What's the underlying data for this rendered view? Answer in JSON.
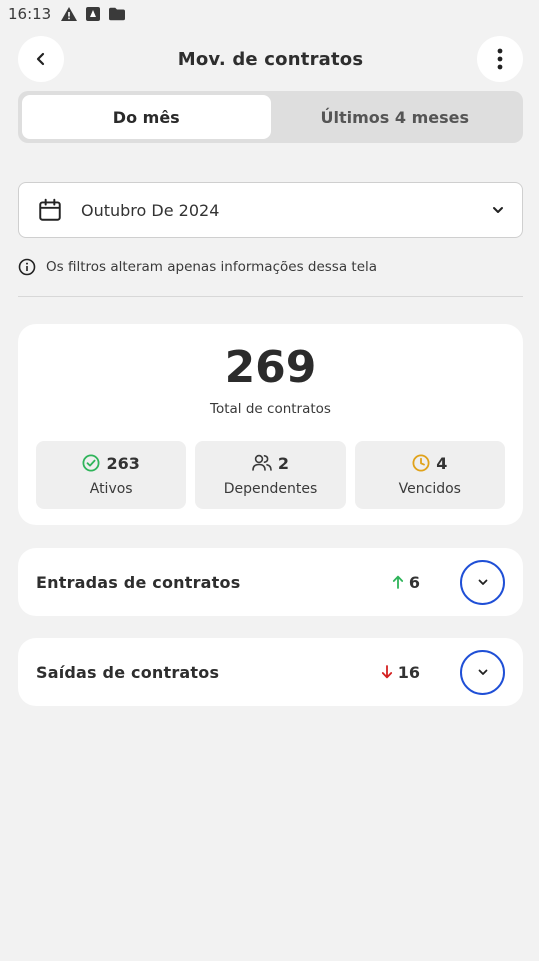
{
  "status_bar": {
    "time": "16:13",
    "icons": [
      "warning-icon",
      "app-notification-icon",
      "folder-icon"
    ]
  },
  "header": {
    "title": "Mov. de contratos",
    "back_icon": "chevron-left-icon",
    "menu_icon": "more-vertical-icon"
  },
  "tabs": [
    {
      "label": "Do mês",
      "active": true
    },
    {
      "label": "Últimos 4 meses",
      "active": false
    }
  ],
  "month_filter": {
    "value": "Outubro De 2024",
    "icon": "calendar-icon",
    "dropdown_icon": "chevron-down-icon"
  },
  "info": {
    "text": "Os filtros alteram apenas informações dessa tela",
    "icon": "info-icon"
  },
  "summary": {
    "total": "269",
    "total_label": "Total de contratos",
    "stats": [
      {
        "value": "263",
        "label": "Ativos",
        "icon": "check-circle-icon",
        "color": "#2fb45a"
      },
      {
        "value": "2",
        "label": "Dependentes",
        "icon": "users-icon",
        "color": "#3a3a3a"
      },
      {
        "value": "4",
        "label": "Vencidos",
        "icon": "clock-icon",
        "color": "#e0a21a"
      }
    ]
  },
  "movements": [
    {
      "title": "Entradas de contratos",
      "count": "6",
      "direction": "up",
      "arrow_color": "#2fb45a"
    },
    {
      "title": "Saídas de contratos",
      "count": "16",
      "direction": "down",
      "arrow_color": "#d42020"
    }
  ],
  "colors": {
    "accent": "#1f4fd6",
    "background": "#f2f2f2"
  }
}
